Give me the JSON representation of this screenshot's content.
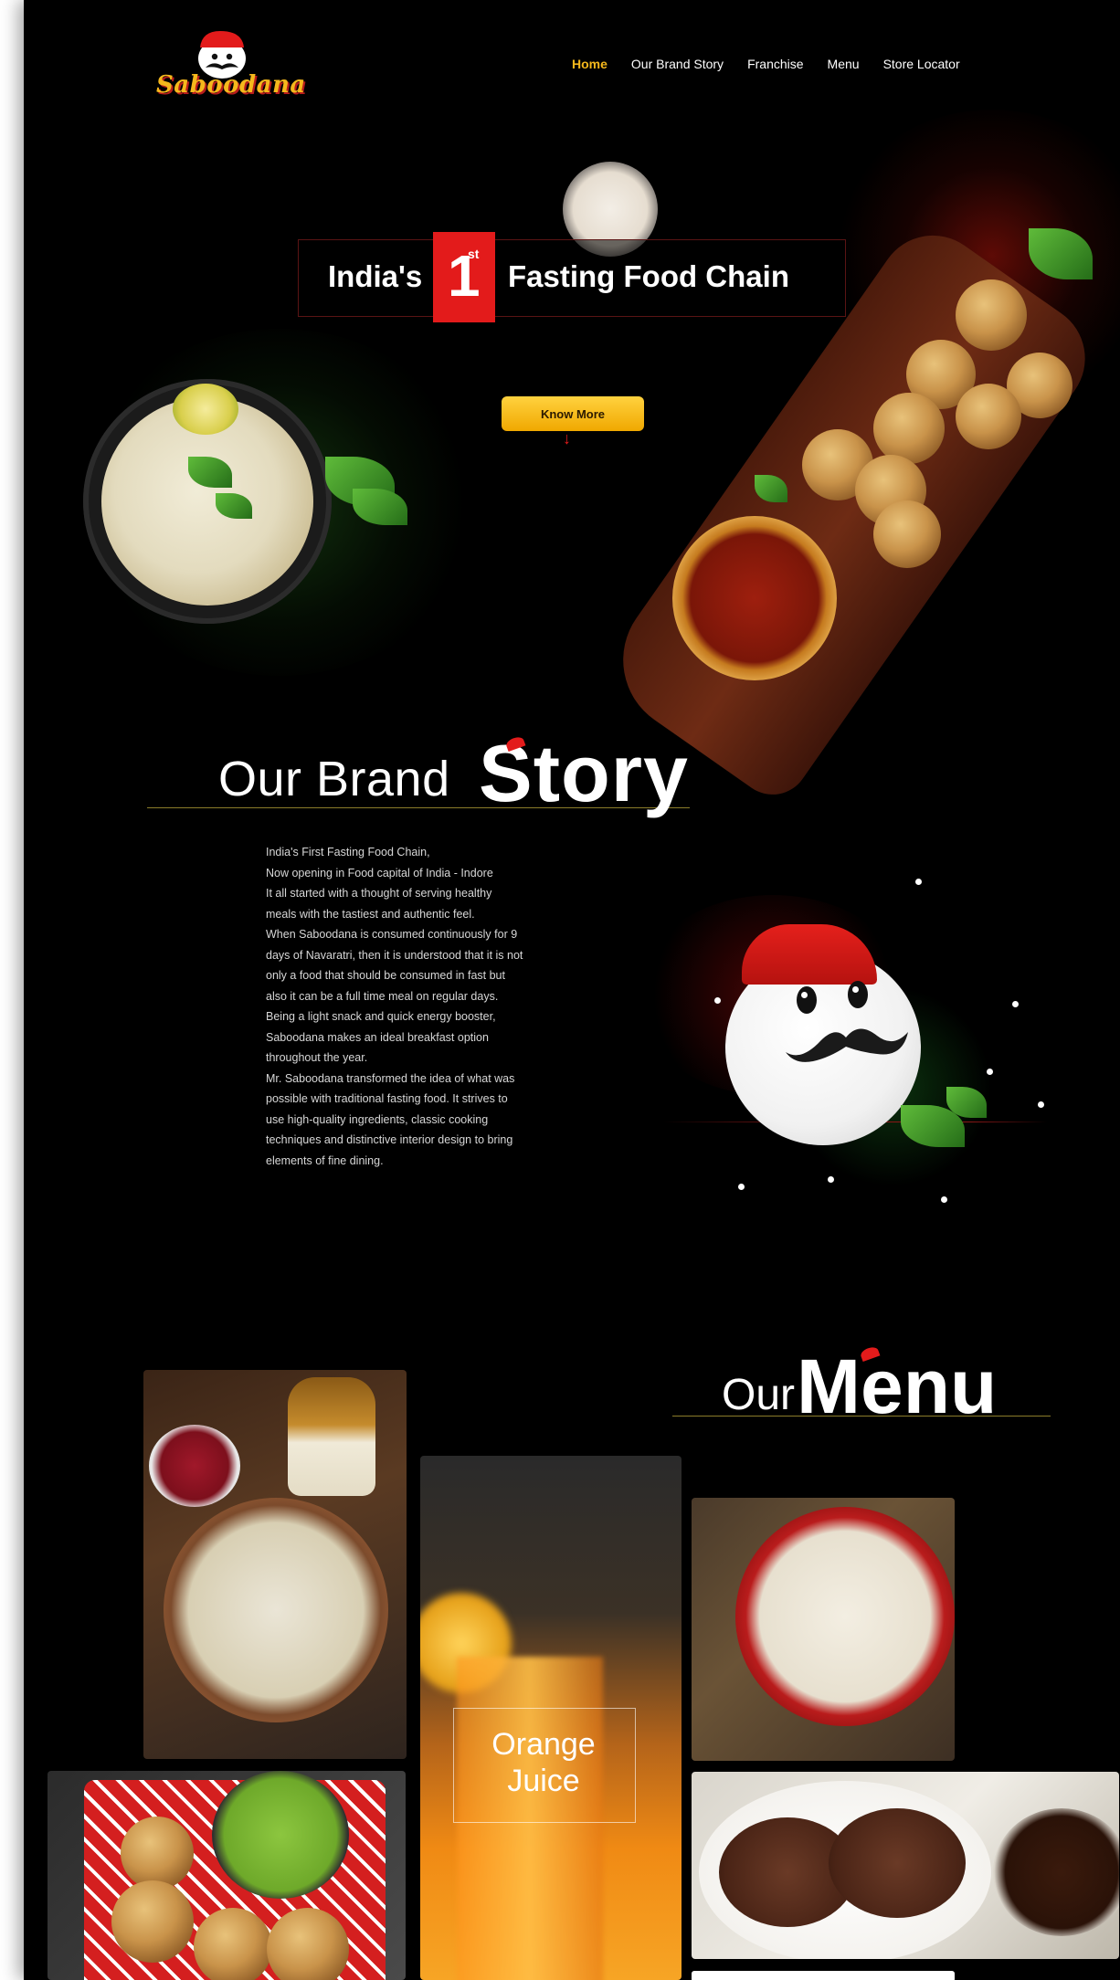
{
  "brand": {
    "logo_text": "Saboodana"
  },
  "nav": {
    "items": [
      {
        "label": "Home",
        "active": true
      },
      {
        "label": "Our Brand Story",
        "active": false
      },
      {
        "label": "Franchise",
        "active": false
      },
      {
        "label": "Menu",
        "active": false
      },
      {
        "label": "Store Locator",
        "active": false
      }
    ]
  },
  "hero": {
    "headline_left": "India's",
    "badge_number": "1",
    "badge_suffix": "st",
    "headline_right": "Fasting Food Chain",
    "cta_label": "Know More"
  },
  "brand_story": {
    "title_light": "Our Brand",
    "title_bold": "Story",
    "lines": [
      "India's First Fasting Food Chain,",
      "Now opening in Food capital of India - Indore",
      "It all started with a thought of serving healthy",
      "meals with the tastiest and authentic feel.",
      "When Saboodana is consumed continuously for 9",
      "days of Navaratri, then it is understood that it is not",
      "only a food that should be consumed in fast but",
      "also it can be a full time meal on regular days.",
      "Being a light snack and quick energy booster,",
      "Saboodana makes an ideal breakfast option",
      "throughout the year.",
      "Mr. Saboodana transformed the idea of what was",
      "possible with traditional fasting food. It strives to",
      "use high-quality ingredients, classic cooking",
      "techniques and distinctive interior design to bring",
      "elements of fine dining."
    ]
  },
  "menu": {
    "title_light": "Our",
    "title_bold": "Menu",
    "featured_label_line1": "Orange",
    "featured_label_line2": "Juice"
  },
  "colors": {
    "accent_yellow": "#f5b81c",
    "accent_red": "#e31b1b",
    "background": "#000000",
    "title_rule": "#8a7c2a"
  }
}
